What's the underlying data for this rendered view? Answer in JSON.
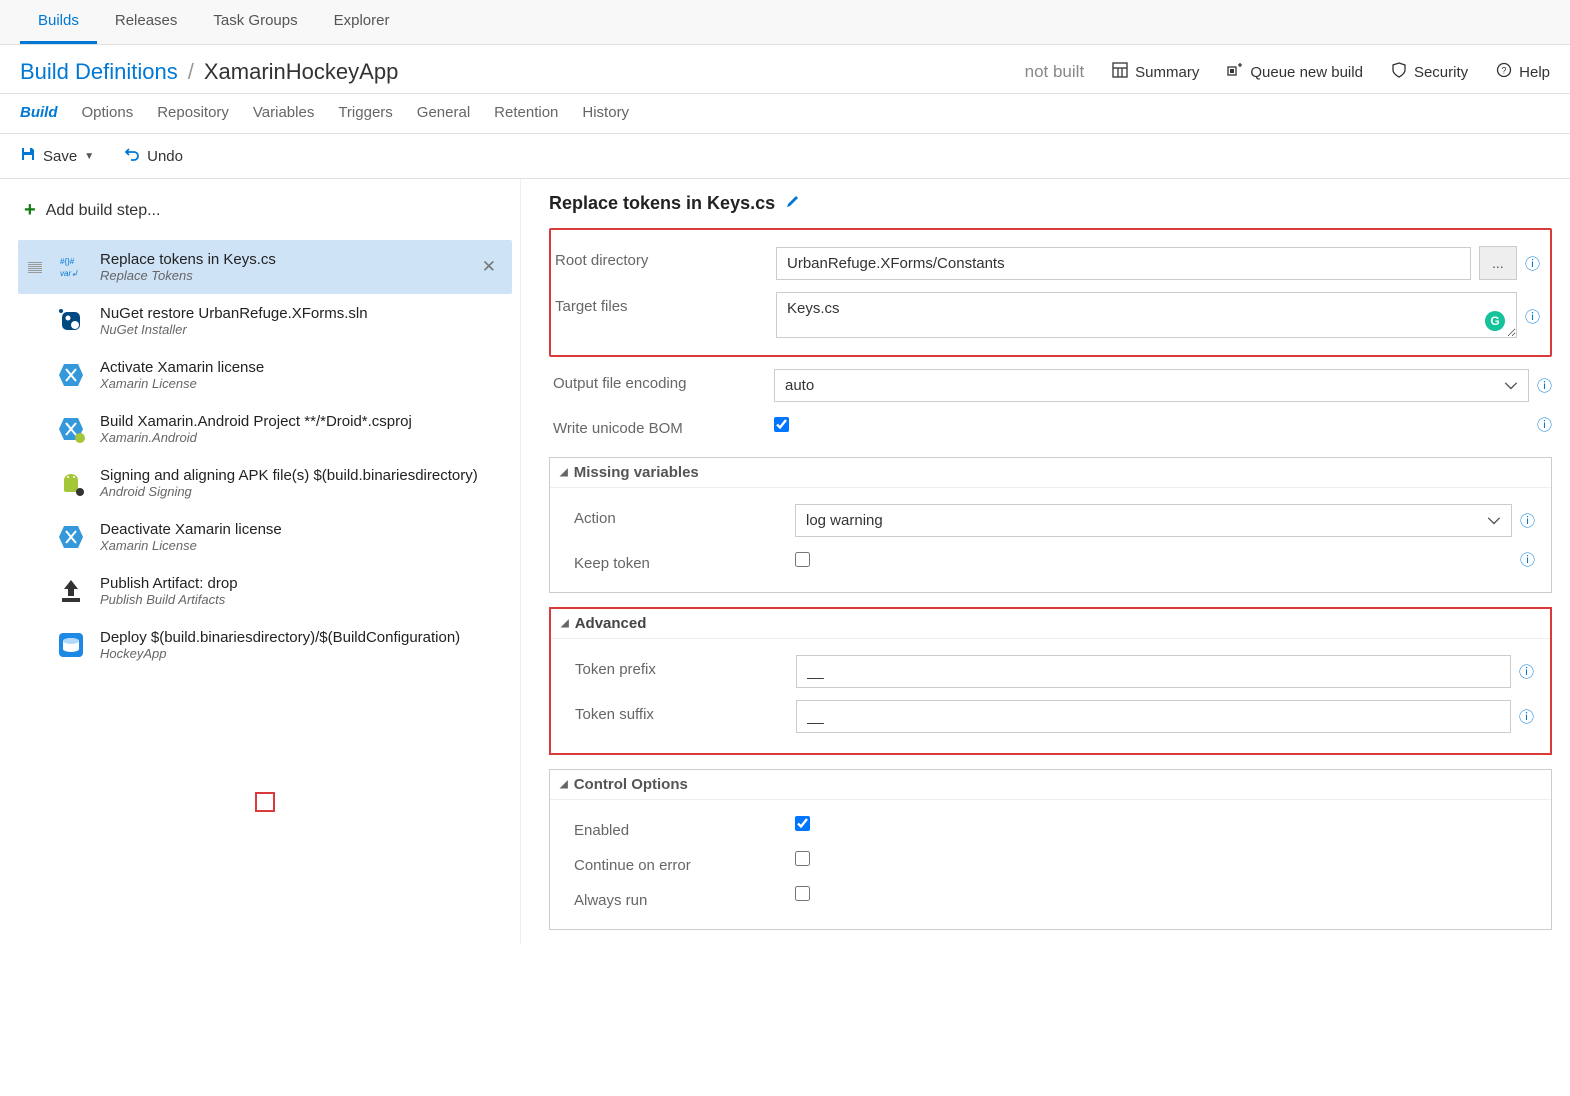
{
  "topTabs": [
    "Builds",
    "Releases",
    "Task Groups",
    "Explorer"
  ],
  "activeTopTab": 0,
  "breadcrumb": {
    "root": "Build Definitions",
    "current": "XamarinHockeyApp"
  },
  "status": "not built",
  "topActions": {
    "summary": "Summary",
    "queue": "Queue new build",
    "security": "Security",
    "help": "Help"
  },
  "subTabs": [
    "Build",
    "Options",
    "Repository",
    "Variables",
    "Triggers",
    "General",
    "Retention",
    "History"
  ],
  "activeSubTab": 0,
  "toolbar": {
    "save": "Save",
    "undo": "Undo"
  },
  "addStep": "Add build step...",
  "steps": [
    {
      "title": "Replace tokens in Keys.cs",
      "sub": "Replace Tokens",
      "icon": "replace"
    },
    {
      "title": "NuGet restore UrbanRefuge.XForms.sln",
      "sub": "NuGet Installer",
      "icon": "nuget"
    },
    {
      "title": "Activate Xamarin license",
      "sub": "Xamarin License",
      "icon": "xamarin"
    },
    {
      "title": "Build Xamarin.Android Project **/*Droid*.csproj",
      "sub": "Xamarin.Android",
      "icon": "xamarin-android"
    },
    {
      "title": "Signing and aligning APK file(s) $(build.binariesdirectory)",
      "sub": "Android Signing",
      "icon": "android"
    },
    {
      "title": "Deactivate Xamarin license",
      "sub": "Xamarin License",
      "icon": "xamarin"
    },
    {
      "title": "Publish Artifact: drop",
      "sub": "Publish Build Artifacts",
      "icon": "publish"
    },
    {
      "title": "Deploy $(build.binariesdirectory)/$(BuildConfiguration)",
      "sub": "HockeyApp",
      "icon": "hockey"
    }
  ],
  "selectedStep": 0,
  "panel": {
    "title": "Replace tokens in Keys.cs",
    "rootDir": {
      "label": "Root directory",
      "value": "UrbanRefuge.XForms/Constants"
    },
    "targetFiles": {
      "label": "Target files",
      "value": "Keys.cs"
    },
    "encoding": {
      "label": "Output file encoding",
      "value": "auto"
    },
    "bom": {
      "label": "Write unicode BOM",
      "checked": true
    },
    "sections": {
      "missing": {
        "title": "Missing variables",
        "action": {
          "label": "Action",
          "value": "log warning"
        },
        "keep": {
          "label": "Keep token",
          "checked": false
        }
      },
      "advanced": {
        "title": "Advanced",
        "prefix": {
          "label": "Token prefix",
          "value": "__"
        },
        "suffix": {
          "label": "Token suffix",
          "value": "__"
        }
      },
      "control": {
        "title": "Control Options",
        "enabled": {
          "label": "Enabled",
          "checked": true
        },
        "continue": {
          "label": "Continue on error",
          "checked": false
        },
        "always": {
          "label": "Always run",
          "checked": false
        }
      }
    }
  }
}
